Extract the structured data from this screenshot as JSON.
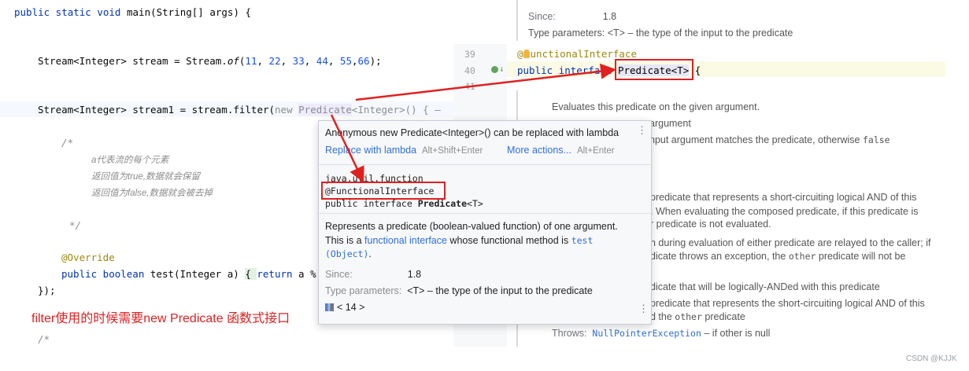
{
  "editor": {
    "line_main": {
      "a": "public static void ",
      "b": "main(String[] args) {"
    },
    "line_stream": {
      "a": "Stream<Integer> stream = Stream.",
      "b": "of",
      "c": "(",
      "n1": "11",
      "s1": ", ",
      "n2": "22",
      "s2": ", ",
      "n3": "33",
      "s3": ", ",
      "n4": "44",
      "s4": ", ",
      "n5": "55",
      "s5": ",",
      "n6": "66",
      "d": ");"
    },
    "line_filter": {
      "a": "Stream<Integer> stream1 = stream.filter(",
      "b": "new ",
      "c": "Predicate",
      "d": "<Integer>() {",
      "e": "—"
    },
    "comment_open": "/*",
    "comment_1": "a代表流的每个元素",
    "comment_2": "返回值为true,数据就会保留",
    "comment_3": "返回值为false,数据就会被去掉",
    "comment_close": "*/",
    "override": "@Override",
    "line_test": {
      "a": "public boolean ",
      "b": "test(Integer a) ",
      "c": "{ ",
      "d": "return",
      "e": " a %"
    },
    "line_close": "});",
    "comment_bottom": "/*"
  },
  "caption": "filter使用的时候需要new Predicate 函数式接口",
  "doc_panel": {
    "since_label": "Since:",
    "since_value": "1.8",
    "type_params": "Type parameters: <T> – the type of the input to the predicate",
    "line_numbers": [
      "39",
      "40",
      "41"
    ],
    "line39": {
      "at": "@",
      "rest": "unctionalInterface"
    },
    "line40": {
      "a": "public interface ",
      "b": "Predicate<T>",
      "c": " {"
    },
    "evaluates": "Evaluates this predicate on the given argument.",
    "frag_argument": "argument",
    "frag_input_a": "nput argument matches the predicate, otherwise ",
    "frag_input_b": "false",
    "frag_pred1": "predicate that represents a short-circuiting logical AND of this",
    "frag_when": ". When evaluating the composed predicate, if this predicate is",
    "frag_r": "r predicate is not evaluated.",
    "frag_during": "n during evaluation of either predicate are relayed to the caller; if",
    "frag_throws_a": "dicate throws an exception, the ",
    "frag_throws_b": "other",
    "frag_throws_c": " predicate will not be",
    "frag_anded": "dicate that will be logically-ANDed with this predicate",
    "frag_pred2": "predicate that represents the short-circuiting logical AND of this",
    "frag_other_a": "d the ",
    "frag_other_b": "other",
    "frag_other_c": " predicate",
    "throws_label": "Throws:",
    "throws_link": "NullPointerException",
    "throws_rest": " – if other is null"
  },
  "popup": {
    "title": "Anonymous new Predicate<Integer>() can be replaced with lambda",
    "replace_action": "Replace with lambda",
    "replace_shortcut": "Alt+Shift+Enter",
    "more_actions": "More actions...",
    "more_shortcut": "Alt+Enter",
    "package": "java.util.function",
    "annotation": "@FunctionalInterface",
    "decl": {
      "a": "public interface ",
      "b": "Predicate",
      "c": "<T>"
    },
    "desc1": "Represents a predicate (boolean-valued function) of one argument.",
    "desc2": {
      "a": "This is a ",
      "b": "functional interface",
      "c": " whose functional method is ",
      "d": "test"
    },
    "desc3": {
      "a": "(Object)",
      "b": "."
    },
    "since_label": "Since:",
    "since_value": "1.8",
    "type_label": "Type parameters:",
    "type_value": "<T> – the type of the input to the predicate",
    "lib": "< 14 >"
  },
  "watermark": "CSDN @KJJK",
  "colors": {
    "annotation_red": "#e02020",
    "link": "#2f6fd6",
    "keyword": "#0033b3"
  }
}
